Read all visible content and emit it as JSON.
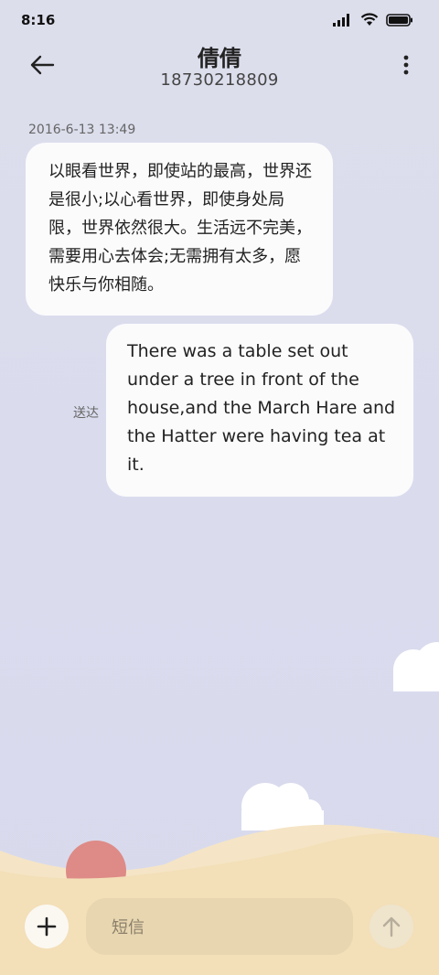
{
  "status_bar": {
    "time": "8:16"
  },
  "header": {
    "contact_name": "倩倩",
    "contact_number": "18730218809"
  },
  "conversation": {
    "timestamp": "2016-6-13 13:49",
    "messages": [
      {
        "direction": "incoming",
        "text": "以眼看世界，即使站的最高，世界还是很小;以心看世界，即使身处局限，世界依然很大。生活远不完美，需要用心去体会;无需拥有太多，愿快乐与你相随。"
      },
      {
        "direction": "outgoing",
        "text": "There was a table set out under a tree in front of the house,and the March Hare and the Hatter were having tea at it.",
        "status": "送达"
      }
    ]
  },
  "composer": {
    "placeholder": "短信"
  },
  "colors": {
    "sun": "#de8a86",
    "sand": "#f3dfb8",
    "input": "#e7d6b0"
  }
}
